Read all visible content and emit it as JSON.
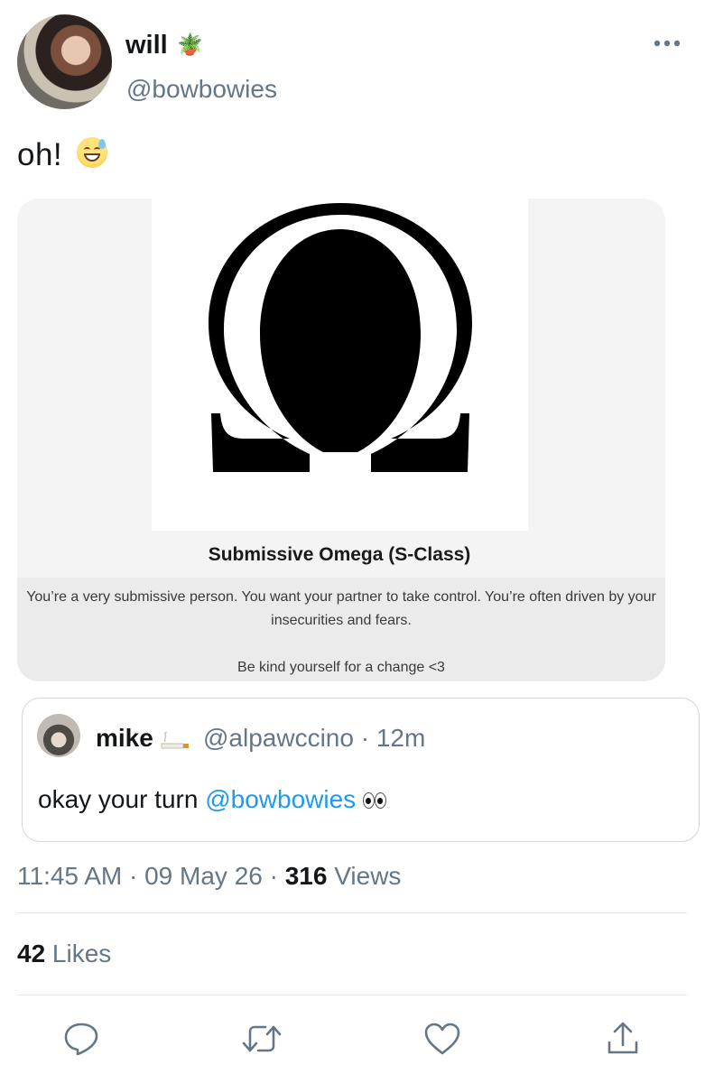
{
  "author": {
    "display_name": "will",
    "name_emoji": "🪴",
    "handle": "@bowbowies",
    "avatar_icon": "profile-photo"
  },
  "tweet": {
    "text": "oh!",
    "text_emoji": "sweat-smile-emoji"
  },
  "card": {
    "image_icon": "omega-symbol",
    "title": "Submissive Omega (S-Class)",
    "description": "You’re a very submissive person. You want your partner to take control. You’re often driven by your insecurities and fears.",
    "footer": "Be kind yourself for a change <3"
  },
  "quote": {
    "display_name": "mike",
    "name_emoji": "cigarette-emoji",
    "handle_time": "@alpawccino · 12m",
    "text": "okay your turn ",
    "mention": "@bowbowies",
    "text_emoji": "eyes-emoji"
  },
  "meta": {
    "time_date": "11:45 AM · 09 May 26 · ",
    "views_count": "316",
    "views_label": " Views"
  },
  "likes": {
    "count": "42",
    "label": " Likes"
  },
  "actions": [
    "reply-icon",
    "retweet-icon",
    "like-icon",
    "share-icon"
  ],
  "colors": {
    "link": "#1d9bf0",
    "secondary_text": "#657786",
    "card_bg": "#f4f4f4"
  }
}
